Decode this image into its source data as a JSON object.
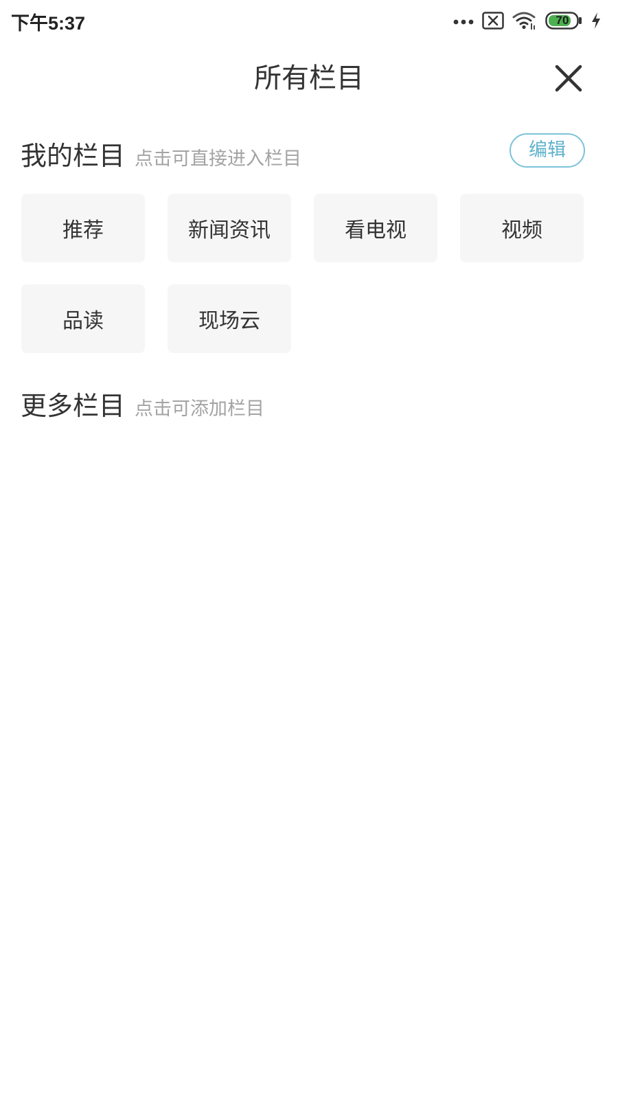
{
  "status_bar": {
    "time": "下午5:37",
    "battery_level": "70",
    "charging": true,
    "icons": [
      "more-dots-icon",
      "no-sim-icon",
      "wifi-icon",
      "battery-icon",
      "charging-icon"
    ]
  },
  "header": {
    "title": "所有栏目",
    "close_icon": "close-icon"
  },
  "my_channels": {
    "title": "我的栏目",
    "hint": "点击可直接进入栏目",
    "edit_label": "编辑",
    "items": [
      {
        "label": "推荐"
      },
      {
        "label": "新闻资讯"
      },
      {
        "label": "看电视"
      },
      {
        "label": "视频"
      },
      {
        "label": "品读"
      },
      {
        "label": "现场云"
      }
    ]
  },
  "more_channels": {
    "title": "更多栏目",
    "hint": "点击可添加栏目",
    "items": []
  },
  "colors": {
    "accent": "#5fb2cc",
    "tile_bg": "#f6f6f6",
    "hint_text": "#a3a3a3",
    "battery_fill": "#4caf50"
  }
}
